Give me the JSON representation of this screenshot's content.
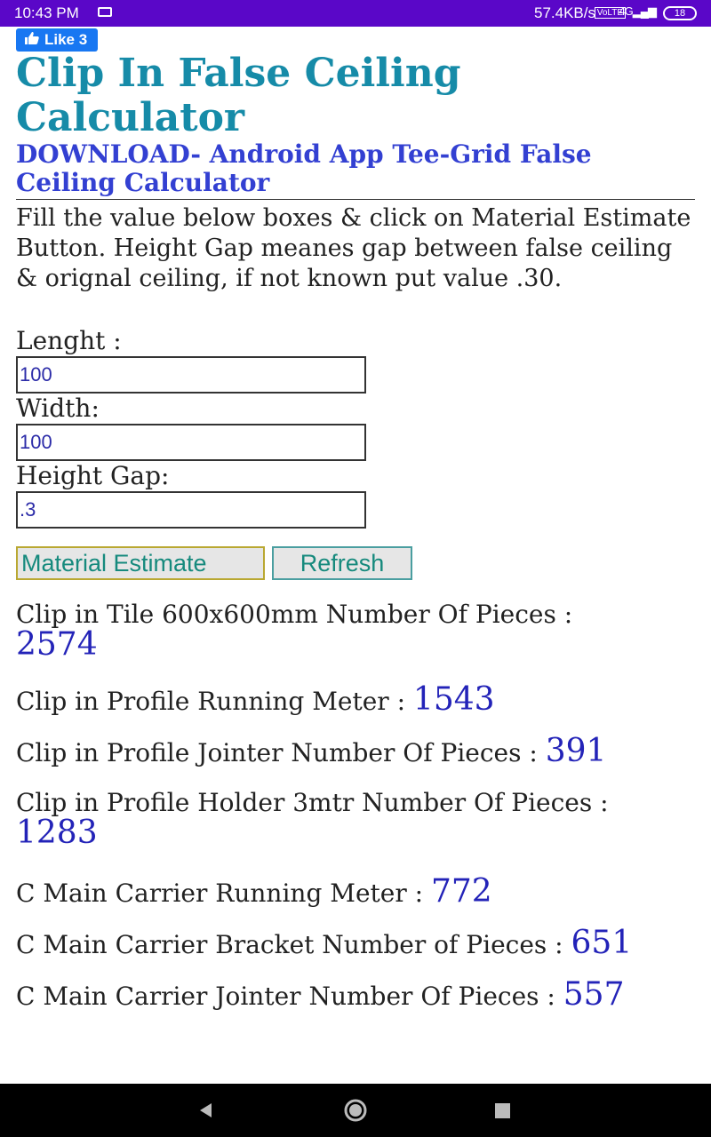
{
  "status_bar": {
    "time": "10:43 PM",
    "speed": "57.4KB/s",
    "network": "VoLTE",
    "signal": "4G",
    "battery": "18"
  },
  "like_button": {
    "label": "Like 3"
  },
  "page": {
    "title": "Clip In False Ceiling Calculator",
    "download_link": "DOWNLOAD- Android App Tee-Grid False Ceiling Calculator",
    "intro": "Fill the value below boxes & click on Material Estimate Button. Height Gap meanes gap between false ceiling & orignal ceiling, if not known put value .30."
  },
  "form": {
    "length_label": "Lenght :",
    "length_value": "100",
    "width_label": "Width:",
    "width_value": "100",
    "height_label": "Height Gap:",
    "height_value": ".3",
    "estimate_button": "Material Estimate",
    "refresh_button": "Refresh"
  },
  "results": [
    {
      "label": "Clip in Tile 600x600mm Number Of Pieces :",
      "value": "2574"
    },
    {
      "label": "Clip in Profile Running Meter :",
      "value": "1543"
    },
    {
      "label": "Clip in Profile Jointer Number Of Pieces :",
      "value": "391"
    },
    {
      "label": "Clip in Profile Holder 3mtr Number Of Pieces :",
      "value": "1283"
    },
    {
      "label": "C Main Carrier Running Meter :",
      "value": "772"
    },
    {
      "label": "C Main Carrier Bracket Number of Pieces :",
      "value": "651"
    },
    {
      "label": "C Main Carrier Jointer Number Of Pieces :",
      "value": "557"
    }
  ],
  "colors": {
    "status_bar": "#5a07c8",
    "title": "#168ba8",
    "link": "#3340d2",
    "value": "#2323b8",
    "like": "#1877f2"
  }
}
